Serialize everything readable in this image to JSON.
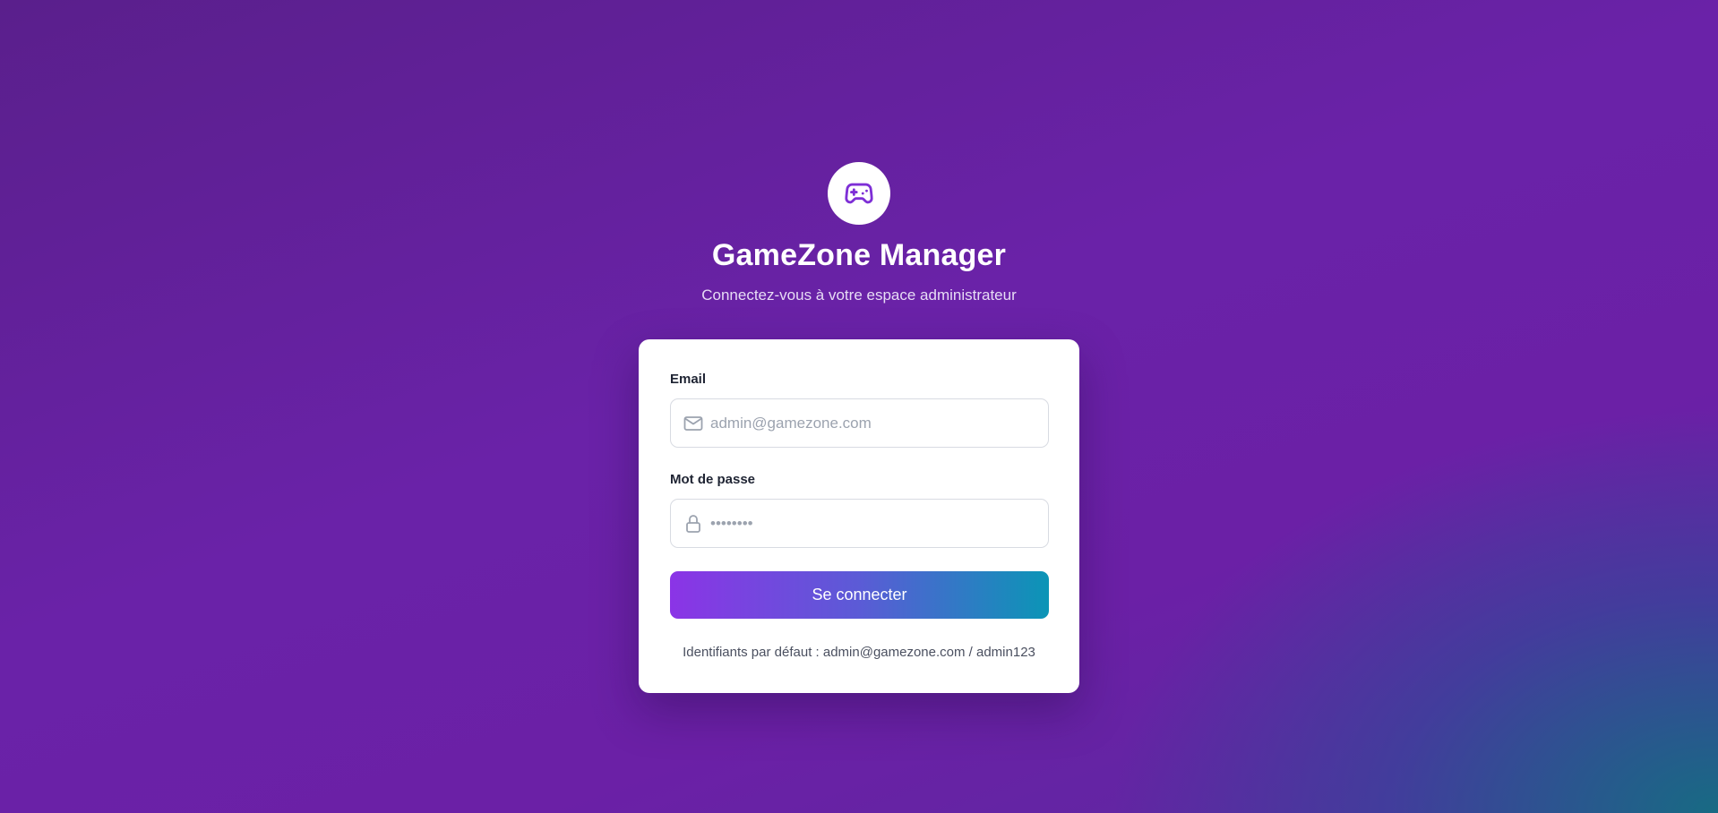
{
  "app": {
    "title": "GameZone Manager",
    "subtitle": "Connectez-vous à votre espace administrateur",
    "logo_icon": "gamepad-icon",
    "accent": "#7e2fd6"
  },
  "form": {
    "email": {
      "label": "Email",
      "placeholder": "admin@gamezone.com",
      "value": "",
      "icon": "mail-icon"
    },
    "password": {
      "label": "Mot de passe",
      "placeholder": "••••••••",
      "value": "",
      "icon": "lock-icon"
    },
    "submit_label": "Se connecter",
    "hint": "Identifiants par défaut : admin@gamezone.com / admin123"
  }
}
